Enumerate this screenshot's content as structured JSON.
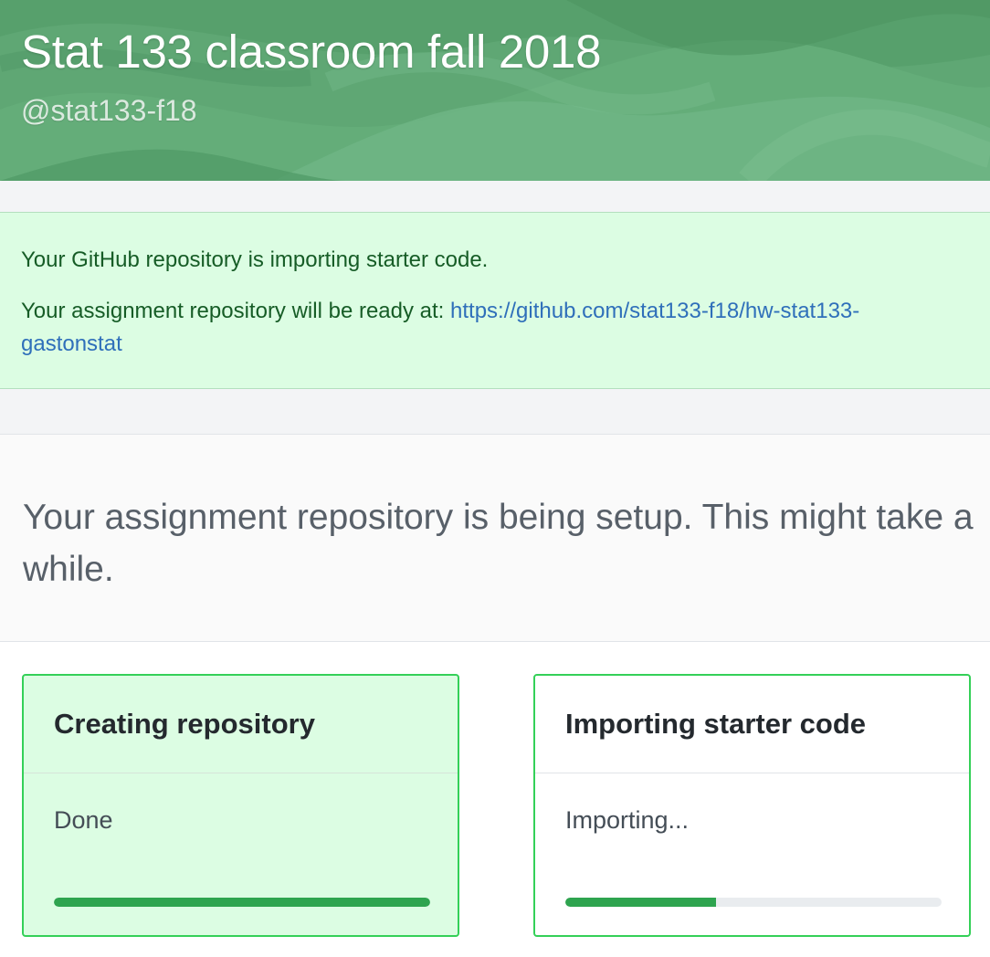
{
  "header": {
    "title": "Stat 133 classroom fall 2018",
    "handle": "@stat133-f18"
  },
  "flash": {
    "line1": "Your GitHub repository is importing starter code.",
    "line2_prefix": "Your assignment repository will be ready at: ",
    "repo_url": "https://github.com/stat133-f18/hw-stat133-gastonstat"
  },
  "setup": {
    "heading": "Your assignment repository is being setup. This might take a while."
  },
  "steps": [
    {
      "title": "Creating repository",
      "status": "Done",
      "progress": 1.0
    },
    {
      "title": "Importing starter code",
      "status": "Importing...",
      "progress": 0.4
    }
  ],
  "colors": {
    "accent_green": "#2ea44f",
    "card_border": "#34d058",
    "flash_bg": "#dcfde3",
    "link": "#2f6fba"
  }
}
